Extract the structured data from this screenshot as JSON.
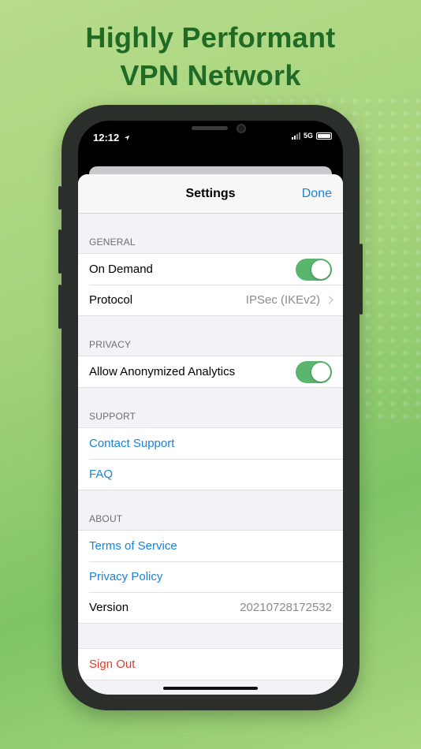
{
  "headline": {
    "line1": "Highly Performant",
    "line2": "VPN Network"
  },
  "status_bar": {
    "time": "12:12",
    "network": "5G"
  },
  "settings": {
    "title": "Settings",
    "done_label": "Done",
    "sections": {
      "general": {
        "header": "GENERAL",
        "on_demand": {
          "label": "On Demand",
          "enabled": true
        },
        "protocol": {
          "label": "Protocol",
          "value": "IPSec (IKEv2)"
        }
      },
      "privacy": {
        "header": "PRIVACY",
        "analytics": {
          "label": "Allow Anonymized Analytics",
          "enabled": true
        }
      },
      "support": {
        "header": "SUPPORT",
        "contact": "Contact Support",
        "faq": "FAQ"
      },
      "about": {
        "header": "ABOUT",
        "terms": "Terms of Service",
        "privacy_policy": "Privacy Policy",
        "version_label": "Version",
        "version_value": "20210728172532"
      },
      "account": {
        "sign_out": "Sign Out"
      }
    }
  },
  "colors": {
    "accent": "#1a82d8",
    "toggle_on": "#5ab66f",
    "danger": "#e53b2f",
    "headline": "#1f6b25"
  }
}
